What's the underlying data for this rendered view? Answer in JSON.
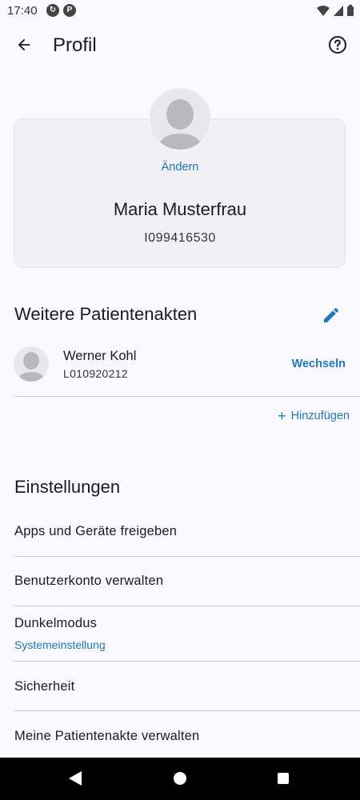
{
  "status_bar": {
    "time": "17:40",
    "icons": [
      "sync-icon",
      "app-notification-icon",
      "wifi-icon",
      "signal-icon",
      "battery-icon"
    ]
  },
  "app_bar": {
    "title": "Profil",
    "back_icon": "arrow-back-icon",
    "help_icon": "help-circle-icon"
  },
  "profile": {
    "change_label": "Ändern",
    "name": "Maria Musterfrau",
    "id": "I099416530"
  },
  "other_records": {
    "title": "Weitere Patientenakten",
    "edit_icon": "pencil-icon",
    "items": [
      {
        "name": "Werner Kohl",
        "id": "L010920212",
        "action": "Wechseln"
      }
    ],
    "add_label": "Hinzufügen"
  },
  "settings": {
    "title": "Einstellungen",
    "items": [
      {
        "label": "Apps und Geräte freigeben"
      },
      {
        "label": "Benutzerkonto verwalten"
      },
      {
        "label": "Dunkelmodus",
        "sub": "Systemeinstellung"
      },
      {
        "label": "Sicherheit"
      },
      {
        "label": "Meine Patientenakte verwalten"
      }
    ]
  },
  "colors": {
    "accent": "#1d79c4",
    "background": "#faf9fd",
    "card": "#f1f0f4",
    "text": "#1c1b1f",
    "divider": "#c9c8cc"
  }
}
